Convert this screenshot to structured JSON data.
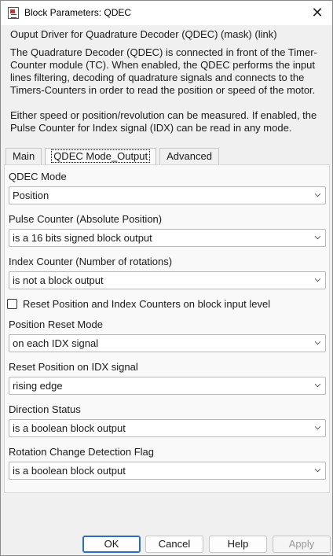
{
  "window": {
    "title": "Block Parameters: QDEC",
    "close_glyph": "✕"
  },
  "mask": {
    "header": "Ouput Driver for Quadrature Decoder (QDEC)  (mask) (link)",
    "description_1": "The Quadrature Decoder (QDEC) is connected in front of the Timer-Counter module (TC). When enabled, the QDEC performs the input lines filtering, decoding of quadrature signals and connects to the Timers-Counters in order to read the position or speed of the motor.",
    "description_2": "Either speed or position/revolution can be measured. If enabled, the Pulse Counter for Index signal (IDX) can be read in any mode."
  },
  "tabs": [
    {
      "label": "Main",
      "active": false
    },
    {
      "label": "QDEC Mode_Output",
      "active": true
    },
    {
      "label": "Advanced",
      "active": false
    }
  ],
  "fields": [
    {
      "label": "QDEC Mode",
      "value": "Position"
    },
    {
      "label": "Pulse Counter (Absolute Position)",
      "value": "is a 16 bits signed block output"
    },
    {
      "label": "Index Counter (Number of rotations)",
      "value": "is not a block output"
    },
    {
      "label": "Position Reset Mode",
      "value": "on each IDX signal"
    },
    {
      "label": "Reset Position on IDX signal",
      "value": "rising edge"
    },
    {
      "label": "Direction Status",
      "value": "is a boolean block output"
    },
    {
      "label": "Rotation Change Detection Flag",
      "value": "is a boolean block output"
    }
  ],
  "checkbox": {
    "label": "Reset Position and Index Counters on block input level",
    "checked": false
  },
  "buttons": {
    "ok": "OK",
    "cancel": "Cancel",
    "help": "Help",
    "apply": "Apply"
  }
}
